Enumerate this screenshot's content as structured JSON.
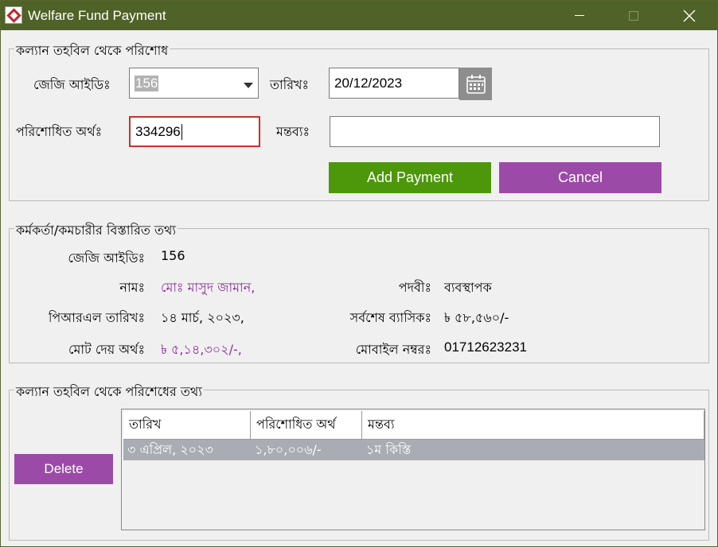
{
  "window": {
    "title": "Welfare Fund Payment"
  },
  "payment_group": {
    "legend": "কল্যান তহবিল থেকে পরিশোধ",
    "gg_id_label": "জেজি আইডিঃ",
    "gg_id_value": "156",
    "date_label": "তারিখঃ",
    "date_value": "20/12/2023",
    "paid_amount_label": "পরিশোধিত অর্থঃ",
    "paid_amount_value": "334296",
    "remarks_label": "মন্তব্যঃ",
    "remarks_value": "",
    "add_payment_label": "Add Payment",
    "cancel_label": "Cancel"
  },
  "employee_group": {
    "legend": "কর্মকর্তা/কমচারীর বিস্তারিত তথ্য",
    "gg_id_label": "জেজি আইডিঃ",
    "gg_id_value": "156",
    "name_label": "নামঃ",
    "name_value": "মোঃ মাসুদ জামান,",
    "designation_label": "পদবীঃ",
    "designation_value": "ব্যবস্থাপক",
    "prl_date_label": "পিআরএল তারিখঃ",
    "prl_date_value": "১৪ মার্চ, ২০২৩,",
    "last_basic_label": "সর্বশেষ ব্যাসিকঃ",
    "last_basic_value": "৳ ৫৮,৫৬০/-",
    "total_payable_label": "মোট দেয় অর্থঃ",
    "total_payable_value": "৳ ৫,১৪,৩০২/-,",
    "mobile_label": "মোবাইল নম্বরঃ",
    "mobile_value": "01712623231"
  },
  "history_group": {
    "legend": "কল্যান তহবিল থেকে পরিশেধের তথ্য",
    "delete_label": "Delete",
    "columns": [
      "তারিখ",
      "পরিশোধিত অর্থ",
      "মন্তব্য"
    ],
    "rows": [
      [
        "৩ এপ্রিল, ২০২৩",
        "১,৮০,০০৬/-",
        "১ম কিস্তি"
      ]
    ]
  },
  "colors": {
    "titlebar": "#4f6227",
    "green_button": "#4d970b",
    "purple_button": "#9c4aa8",
    "accent_text": "#8a2d96",
    "focus_border": "#c8312e"
  }
}
